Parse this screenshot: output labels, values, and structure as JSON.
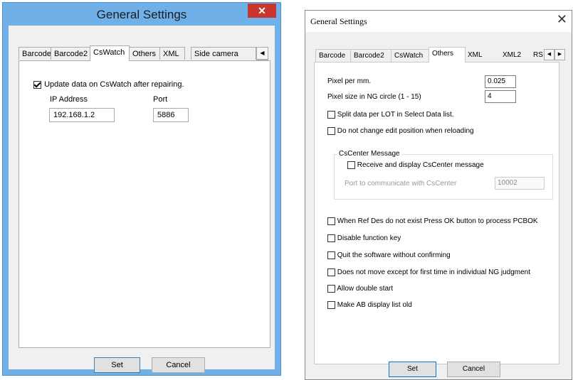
{
  "left_dialog": {
    "title": "General Settings",
    "close_glyph": "✕",
    "tabs": [
      "Barcode",
      "Barcode2",
      "CsWatch",
      "Others",
      "XML",
      "Side camera"
    ],
    "active_tab": "CsWatch",
    "update_checkbox": {
      "label": "Update data on CsWatch after repairing.",
      "checked": true
    },
    "ip_label": "IP Address",
    "ip_value": "192.168.1.2",
    "port_label": "Port",
    "port_value": "5886",
    "set_label": "Set",
    "cancel_label": "Cancel"
  },
  "right_dialog": {
    "title": "General Settings",
    "close_glyph": "✕",
    "tabs": [
      "Barcode",
      "Barcode2",
      "CsWatch",
      "Others",
      "XML",
      "XML2",
      "RS"
    ],
    "active_tab": "Others",
    "pixel_per_mm_label": "Pixel per mm.",
    "pixel_per_mm_value": "0.025",
    "pixel_size_label": "Pixel size in NG circle (1 - 15)",
    "pixel_size_value": "4",
    "split_lot_label": "Split data per LOT in Select Data list.",
    "no_change_edit_label": "Do not change edit position when reloading",
    "cscenter_group_label": "CsCenter Message",
    "receive_cscenter_label": "Receive and display CsCenter message",
    "cscenter_port_label": "Port to communicate with CsCenter",
    "cscenter_port_value": "10002",
    "options": [
      "When Ref Des do not exist Press OK button to process PCBOK",
      "Disable function key",
      "Quit the software without confirming",
      "Does not move except for first time in individual NG judgment",
      "Allow double start",
      "Make AB display list old"
    ],
    "set_label": "Set",
    "cancel_label": "Cancel"
  },
  "icons": {
    "scroll_left": "◀",
    "scroll_right": "▶"
  },
  "colors": {
    "left_frame": "#6fb0e8",
    "close_red": "#c7372f"
  }
}
